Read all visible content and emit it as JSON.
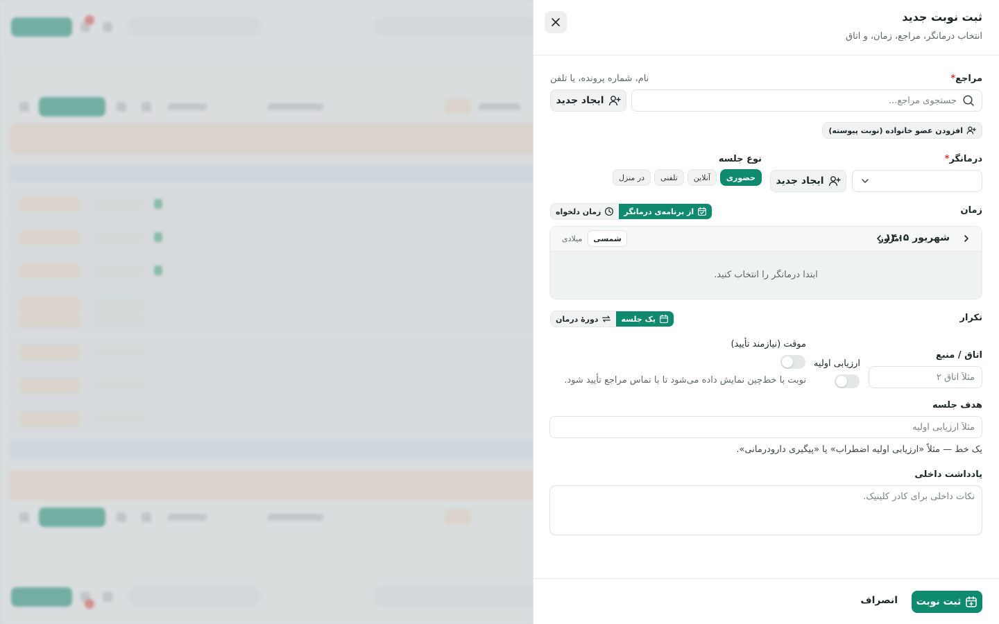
{
  "drawer": {
    "title": "ثبت نوبت جدید",
    "subtitle": "انتخاب درمانگر، مراجع، زمان، و اتاق",
    "client": {
      "label": "مراجع",
      "hint": "نام، شماره پرونده، یا تلفن",
      "search_placeholder": "جستجوی مراجع...",
      "create_label": "ایجاد جدید",
      "family_label": "افزودن عضو خانواده (نوبت پیوسته)"
    },
    "therapist": {
      "label": "درمانگر",
      "create_label": "ایجاد جدید"
    },
    "session_type": {
      "label": "نوع جلسه",
      "options": [
        "حضوری",
        "آنلاین",
        "تلفنی",
        "در منزل"
      ],
      "selected": "حضوری"
    },
    "time": {
      "label": "زمان",
      "mode_schedule": "از برنامه‌ی درمانگر",
      "mode_custom": "زمان دلخواه",
      "month": "شهریور ۱۴۰۵",
      "today": "امروز",
      "cal_shamsi": "شمسی",
      "cal_miladi": "میلادی",
      "empty": "ابتدا درمانگر را انتخاب کنید."
    },
    "repeat": {
      "label": "تکرار",
      "single": "یک جلسه",
      "course": "دورهٔ درمان"
    },
    "room": {
      "label": "اتاق / منبع",
      "placeholder": "مثلاً اتاق ۲"
    },
    "initial_assessment": {
      "label": "ارزیابی اولیه"
    },
    "tentative": {
      "label": "موقت (نیازمند تأیید)",
      "description": "نوبت با خط‌چین نمایش داده می‌شود تا با تماس مراجع تأیید شود."
    },
    "goal": {
      "label": "هدف جلسه",
      "placeholder": "مثلاً ارزیابی اولیه",
      "hint": "یک خط — مثلاً «ارزیابی اولیه اضطراب» یا «پیگیری دارودرمانی»."
    },
    "note": {
      "label": "یادداشت داخلی",
      "placeholder": "نکات داخلی برای کادر کلینیک."
    },
    "footer": {
      "submit": "ثبت نوبت",
      "cancel": "انصراف"
    }
  },
  "colors": {
    "accent": "#0f8a6f",
    "required": "#dd3333"
  },
  "icons": [
    "close-icon",
    "search-icon",
    "user-plus-icon",
    "chevron-down-icon",
    "calendar-check-icon",
    "clock-icon",
    "chevron-right-icon",
    "chevron-left-icon",
    "calendar-icon",
    "repeat-icon",
    "calendar-plus-icon"
  ]
}
